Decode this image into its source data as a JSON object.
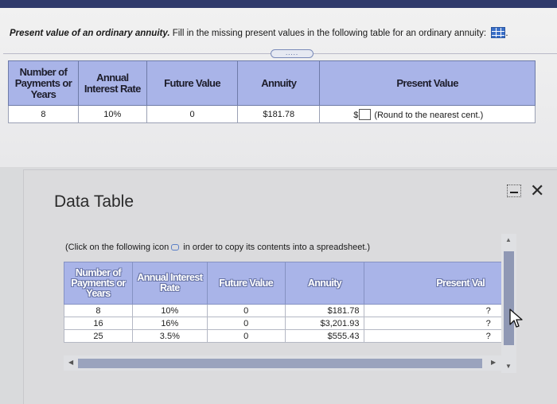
{
  "question": {
    "lead": "Present value of an ordinary annuity.",
    "instruction": "Fill in the missing present values in the following table for an ordinary annuity:",
    "trailing": ".",
    "data_icon": "grid-table-icon"
  },
  "expand_button": {
    "label": "....."
  },
  "main_table": {
    "headers": [
      "Number of Payments or Years",
      "Annual Interest Rate",
      "Future Value",
      "Annuity",
      "Present Value"
    ],
    "row": {
      "years": "8",
      "rate": "10%",
      "future_value": "0",
      "annuity": "$181.78",
      "currency": "$",
      "hint": "(Round to the nearest cent.)"
    }
  },
  "modal": {
    "title": "Data Table",
    "copy_note_prefix": "(Click on the following icon",
    "copy_note_suffix": "in order to copy its contents into a spreadsheet.)",
    "headers": [
      "Number of Payments or Years",
      "Annual Interest Rate",
      "Future Value",
      "Annuity",
      "Present Val"
    ],
    "rows": [
      {
        "years": "8",
        "rate": "10%",
        "fv": "0",
        "annuity": "$181.78",
        "pv": "?"
      },
      {
        "years": "16",
        "rate": "16%",
        "fv": "0",
        "annuity": "$3,201.93",
        "pv": "?"
      },
      {
        "years": "25",
        "rate": "3.5%",
        "fv": "0",
        "annuity": "$555.43",
        "pv": "?"
      }
    ]
  },
  "colors": {
    "header_fill": "#a9b4e8",
    "top_bar": "#2f3a6b",
    "scroll_thumb": "#8f98b4"
  }
}
